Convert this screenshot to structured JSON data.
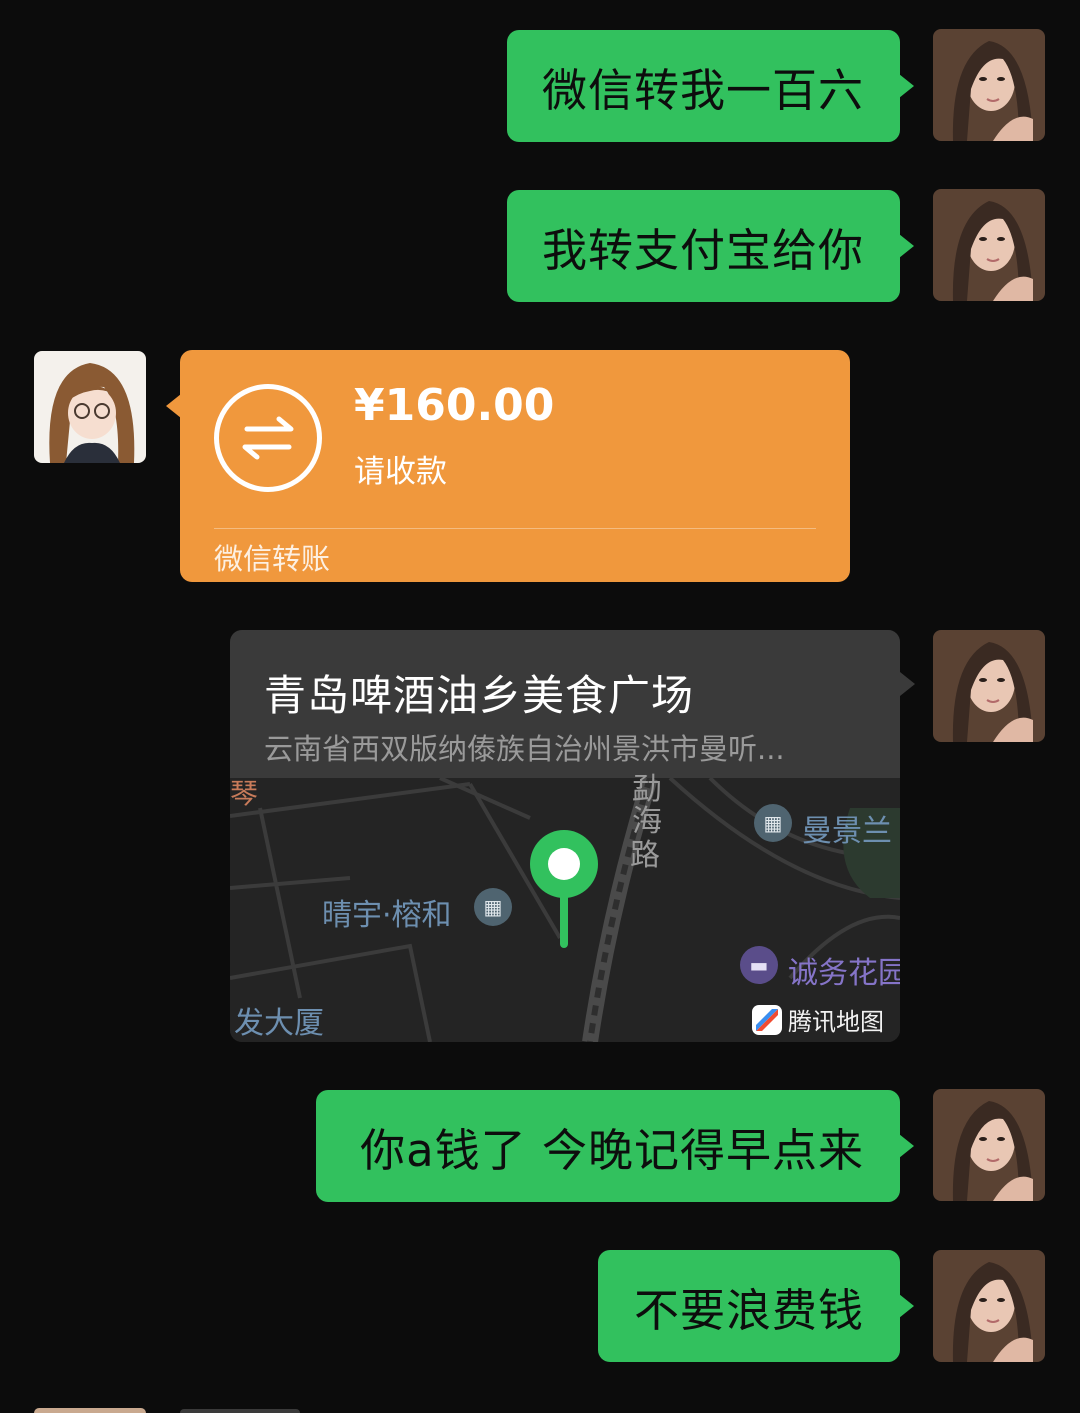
{
  "messages": [
    {
      "side": "right",
      "text": "微信转我一百六"
    },
    {
      "side": "right",
      "text": "我转支付宝给你"
    },
    {
      "side": "left",
      "type": "transfer",
      "amount": "¥160.00",
      "subtitle": "请收款",
      "footer": "微信转账"
    },
    {
      "side": "right",
      "type": "location",
      "title": "青岛啤酒油乡美食广场",
      "address": "云南省西双版纳傣族自治州景洪市曼听...",
      "map_labels": [
        "琴",
        "勐",
        "海",
        "路",
        "曼景兰",
        "晴宇·榕和",
        "诚务花园",
        "发大厦"
      ],
      "map_provider": "腾讯地图"
    },
    {
      "side": "right",
      "text": "你a钱了 今晚记得早点来"
    },
    {
      "side": "right",
      "text": "不要浪费钱"
    }
  ],
  "colors": {
    "outgoing_bubble": "#32c15e",
    "transfer_card": "#f0983d",
    "background": "#0c0c0c"
  }
}
